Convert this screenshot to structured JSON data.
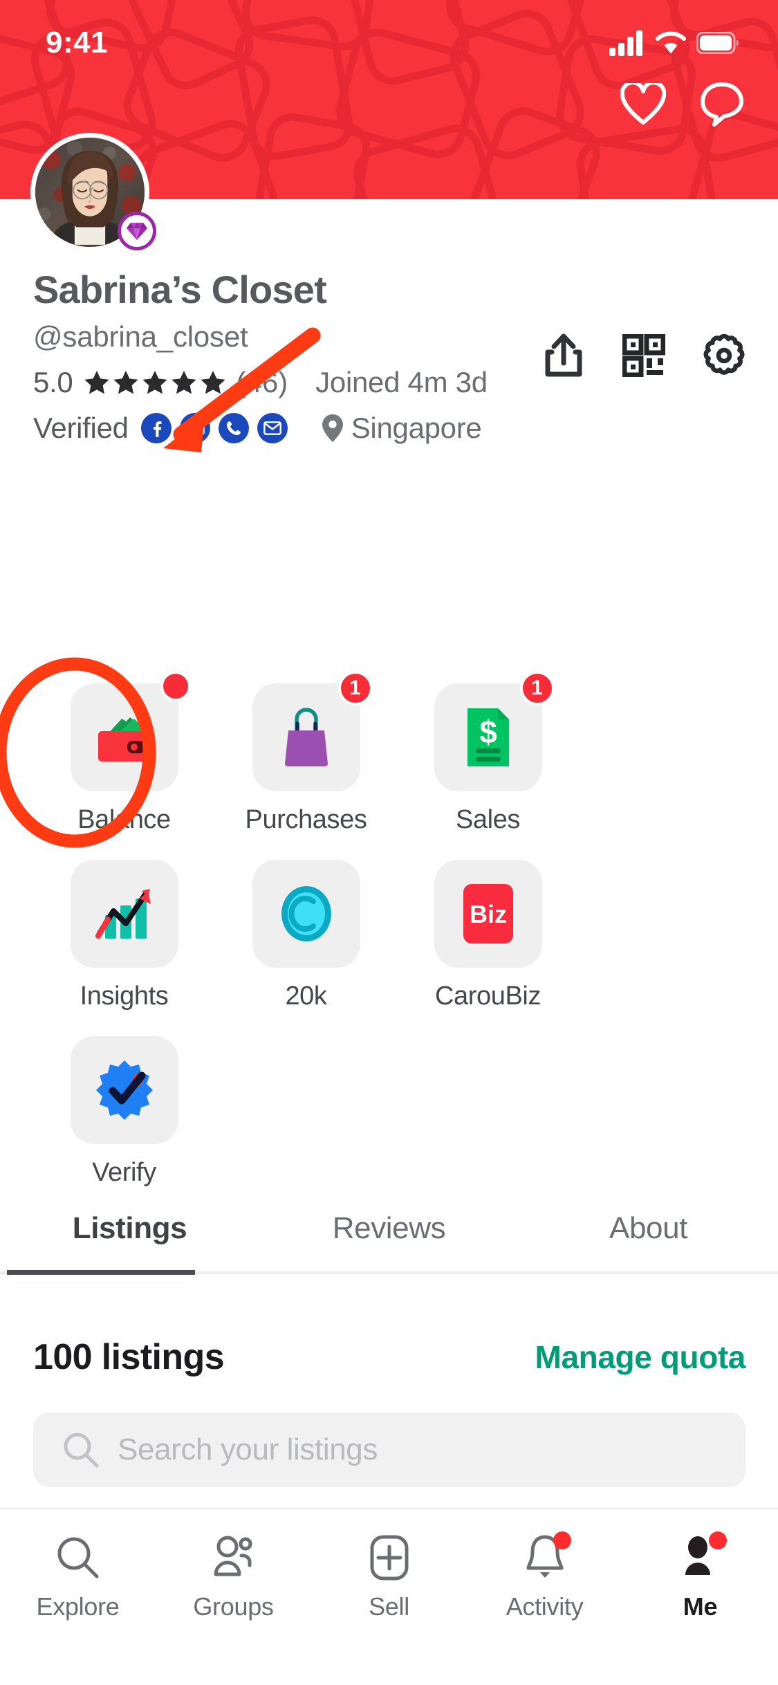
{
  "status_bar": {
    "time": "9:41",
    "icons": [
      "cellular-signal-icon",
      "wifi-icon",
      "battery-icon"
    ]
  },
  "header": {
    "background_color": "#f8333c",
    "actions": [
      {
        "name": "heart-icon",
        "label": "Likes"
      },
      {
        "name": "chat-bubble-icon",
        "label": "Chats"
      }
    ]
  },
  "profile": {
    "name": "Sabrina’s Closet",
    "handle": "@sabrina_closet",
    "avatar_badge": "diamond-icon",
    "rating": "5.0",
    "stars": 5,
    "review_count": "(46)",
    "joined": "Joined 4m 3d",
    "verified_label": "Verified",
    "verified_badges": [
      "facebook-icon",
      "id-card-icon",
      "phone-icon",
      "email-icon"
    ],
    "location": "Singapore",
    "tools": [
      "share-icon",
      "qr-code-icon",
      "gear-icon"
    ]
  },
  "action_grid": [
    {
      "label": "Balance",
      "icon": "wallet-icon",
      "badge": "",
      "badge_dot": true
    },
    {
      "label": "Purchases",
      "icon": "shopping-bag-icon",
      "badge": "1",
      "badge_dot": false
    },
    {
      "label": "Sales",
      "icon": "invoice-dollar-icon",
      "badge": "1",
      "badge_dot": false
    },
    {
      "label": "Insights",
      "icon": "growth-chart-icon",
      "badge": "",
      "badge_dot": false
    },
    {
      "label": "20k",
      "icon": "coin-icon",
      "badge": "",
      "badge_dot": false
    },
    {
      "label": "CarouBiz",
      "icon": "biz-icon",
      "badge": "",
      "badge_dot": false
    },
    {
      "label": "Verify",
      "icon": "verified-check-icon",
      "badge": "",
      "badge_dot": false
    }
  ],
  "tabs": [
    {
      "label": "Listings",
      "active": true
    },
    {
      "label": "Reviews",
      "active": false
    },
    {
      "label": "About",
      "active": false
    }
  ],
  "listings": {
    "count_label": "100 listings",
    "manage_quota_label": "Manage quota",
    "manage_quota_color": "#009b77",
    "search_placeholder": "Search your listings"
  },
  "bottom_nav": [
    {
      "label": "Explore",
      "icon": "search-icon",
      "active": false,
      "dot": false
    },
    {
      "label": "Groups",
      "icon": "people-icon",
      "active": false,
      "dot": false
    },
    {
      "label": "Sell",
      "icon": "plus-square-icon",
      "active": false,
      "dot": false
    },
    {
      "label": "Activity",
      "icon": "bell-icon",
      "active": false,
      "dot": true
    },
    {
      "label": "Me",
      "icon": "person-icon",
      "active": true,
      "dot": true
    }
  ],
  "annotation": {
    "type": "highlight",
    "color": "#ff3b14",
    "target": "Balance",
    "shapes": [
      "ellipse",
      "arrow"
    ]
  }
}
